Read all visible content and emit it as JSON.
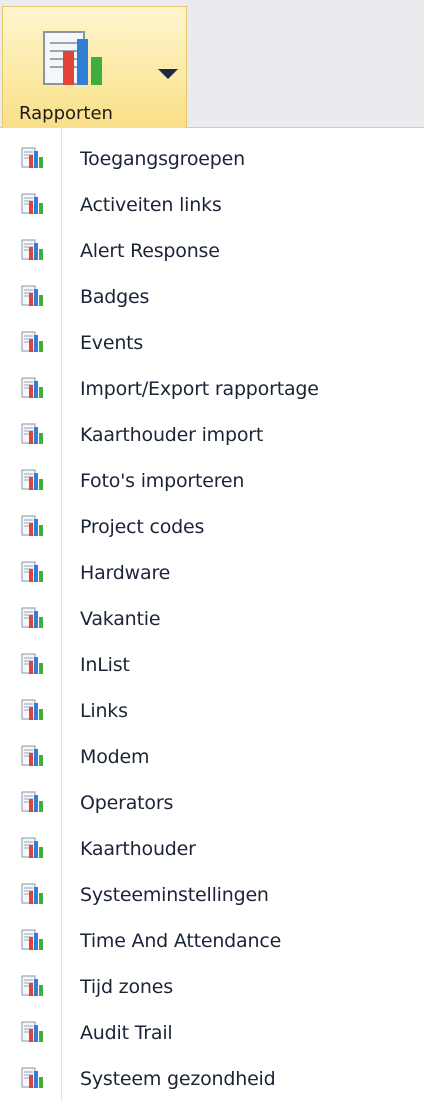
{
  "ribbon": {
    "reports_label": "Rapporten",
    "icon": "report-chart-icon",
    "dropdown_icon": "caret-down-icon"
  },
  "menu": {
    "item_icon": "report-chart-icon",
    "items": [
      "Toegangsgroepen",
      "Activeiten links",
      "Alert Response",
      "Badges",
      "Events",
      "Import/Export rapportage",
      "Kaarthouder import",
      "Foto's importeren",
      "Project codes",
      "Hardware",
      "Vakantie",
      "InList",
      "Links",
      "Modem",
      "Operators",
      "Kaarthouder",
      "Systeeminstellingen",
      "Time And Attendance",
      "Tijd zones",
      "Audit Trail",
      "Systeem gezondheid"
    ]
  },
  "colors": {
    "ribbon_bg": "#e9ebee",
    "button_highlight": "#fce9a3",
    "bar_red": "#e0433a",
    "bar_blue": "#2f7fd6",
    "bar_green": "#3fae3f"
  }
}
